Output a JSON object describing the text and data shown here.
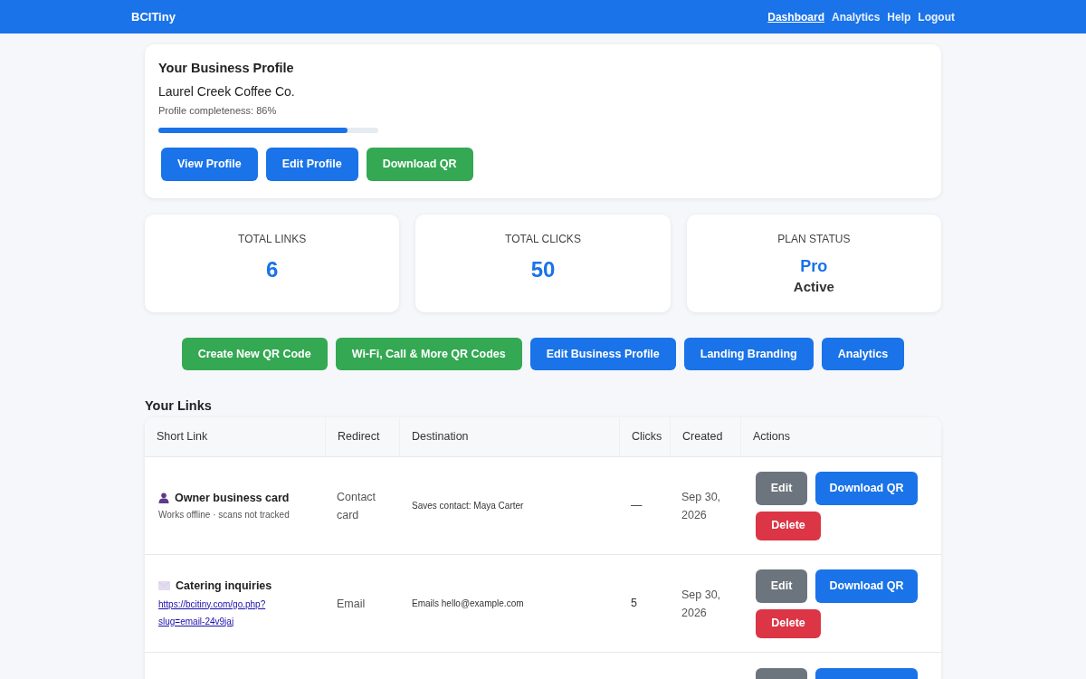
{
  "navbar": {
    "brand": "BCITiny",
    "links": [
      {
        "label": "Dashboard",
        "selected": true
      },
      {
        "label": "Analytics",
        "selected": false
      },
      {
        "label": "Help",
        "selected": false
      },
      {
        "label": "Logout",
        "selected": false
      }
    ]
  },
  "profile": {
    "title": "Your Business Profile",
    "name": "Laurel Creek Coffee Co.",
    "completeness": "Profile completeness: 86%",
    "level": 0.86,
    "buttons": [
      {
        "label": "View Profile",
        "kind": "primary"
      },
      {
        "label": "Edit Profile",
        "kind": "primary"
      },
      {
        "label": "Download QR",
        "kind": "success"
      }
    ]
  },
  "stats": [
    {
      "label": "TOTAL LINKS",
      "value": "6"
    },
    {
      "label": "TOTAL CLICKS",
      "value": "50"
    },
    {
      "label": "PLAN STATUS",
      "value": "Pro",
      "status": "Active"
    }
  ],
  "actions": [
    {
      "label": "Create New QR Code",
      "kind": "success"
    },
    {
      "label": "Wi-Fi, Call & More QR Codes",
      "kind": "success"
    },
    {
      "label": "Edit Business Profile",
      "kind": "primary"
    },
    {
      "label": "Landing Branding",
      "kind": "primary"
    },
    {
      "label": "Analytics",
      "kind": "primary"
    }
  ],
  "links_table": {
    "title": "Your Links",
    "columns": [
      "Short Link",
      "Redirect",
      "Destination",
      "Clicks",
      "Created",
      "Actions"
    ],
    "rows": [
      {
        "kind": "contact",
        "title": "Owner business card",
        "note": "Works offline · scans not tracked",
        "redirect": "Contact card",
        "destination": "Saves contact: Maya Carter",
        "clicks": "—",
        "created": "Sep 30, 2026",
        "actions": [
          {
            "label": "Edit",
            "kind": "secondary"
          },
          {
            "label": "Download QR",
            "kind": "primary"
          },
          {
            "label": "Delete",
            "kind": "danger"
          }
        ]
      },
      {
        "kind": "email",
        "title": "Catering inquiries",
        "link": "https://bcitiny.com/go.php?slug=email-24v9jaj",
        "redirect": "Email",
        "destination": "Emails hello@example.com",
        "clicks": "5",
        "created": "Sep 30, 2026",
        "actions": [
          {
            "label": "Edit",
            "kind": "secondary"
          },
          {
            "label": "Download QR",
            "kind": "primary"
          },
          {
            "label": "Delete",
            "kind": "danger"
          }
        ]
      },
      {
        "actions": [
          {
            "kind": "secondary"
          },
          {
            "kind": "primary"
          }
        ]
      }
    ]
  }
}
